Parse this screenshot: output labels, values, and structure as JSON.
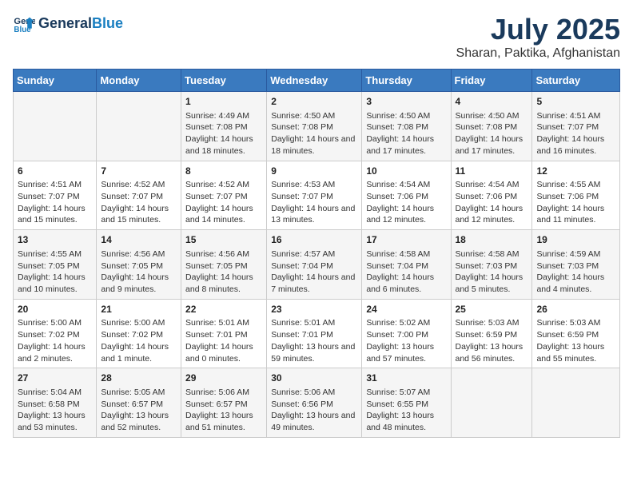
{
  "header": {
    "logo_line1": "General",
    "logo_line2": "Blue",
    "title": "July 2025",
    "subtitle": "Sharan, Paktika, Afghanistan"
  },
  "weekdays": [
    "Sunday",
    "Monday",
    "Tuesday",
    "Wednesday",
    "Thursday",
    "Friday",
    "Saturday"
  ],
  "weeks": [
    [
      {
        "day": "",
        "info": ""
      },
      {
        "day": "",
        "info": ""
      },
      {
        "day": "1",
        "info": "Sunrise: 4:49 AM\nSunset: 7:08 PM\nDaylight: 14 hours and 18 minutes."
      },
      {
        "day": "2",
        "info": "Sunrise: 4:50 AM\nSunset: 7:08 PM\nDaylight: 14 hours and 18 minutes."
      },
      {
        "day": "3",
        "info": "Sunrise: 4:50 AM\nSunset: 7:08 PM\nDaylight: 14 hours and 17 minutes."
      },
      {
        "day": "4",
        "info": "Sunrise: 4:50 AM\nSunset: 7:08 PM\nDaylight: 14 hours and 17 minutes."
      },
      {
        "day": "5",
        "info": "Sunrise: 4:51 AM\nSunset: 7:07 PM\nDaylight: 14 hours and 16 minutes."
      }
    ],
    [
      {
        "day": "6",
        "info": "Sunrise: 4:51 AM\nSunset: 7:07 PM\nDaylight: 14 hours and 15 minutes."
      },
      {
        "day": "7",
        "info": "Sunrise: 4:52 AM\nSunset: 7:07 PM\nDaylight: 14 hours and 15 minutes."
      },
      {
        "day": "8",
        "info": "Sunrise: 4:52 AM\nSunset: 7:07 PM\nDaylight: 14 hours and 14 minutes."
      },
      {
        "day": "9",
        "info": "Sunrise: 4:53 AM\nSunset: 7:07 PM\nDaylight: 14 hours and 13 minutes."
      },
      {
        "day": "10",
        "info": "Sunrise: 4:54 AM\nSunset: 7:06 PM\nDaylight: 14 hours and 12 minutes."
      },
      {
        "day": "11",
        "info": "Sunrise: 4:54 AM\nSunset: 7:06 PM\nDaylight: 14 hours and 12 minutes."
      },
      {
        "day": "12",
        "info": "Sunrise: 4:55 AM\nSunset: 7:06 PM\nDaylight: 14 hours and 11 minutes."
      }
    ],
    [
      {
        "day": "13",
        "info": "Sunrise: 4:55 AM\nSunset: 7:05 PM\nDaylight: 14 hours and 10 minutes."
      },
      {
        "day": "14",
        "info": "Sunrise: 4:56 AM\nSunset: 7:05 PM\nDaylight: 14 hours and 9 minutes."
      },
      {
        "day": "15",
        "info": "Sunrise: 4:56 AM\nSunset: 7:05 PM\nDaylight: 14 hours and 8 minutes."
      },
      {
        "day": "16",
        "info": "Sunrise: 4:57 AM\nSunset: 7:04 PM\nDaylight: 14 hours and 7 minutes."
      },
      {
        "day": "17",
        "info": "Sunrise: 4:58 AM\nSunset: 7:04 PM\nDaylight: 14 hours and 6 minutes."
      },
      {
        "day": "18",
        "info": "Sunrise: 4:58 AM\nSunset: 7:03 PM\nDaylight: 14 hours and 5 minutes."
      },
      {
        "day": "19",
        "info": "Sunrise: 4:59 AM\nSunset: 7:03 PM\nDaylight: 14 hours and 4 minutes."
      }
    ],
    [
      {
        "day": "20",
        "info": "Sunrise: 5:00 AM\nSunset: 7:02 PM\nDaylight: 14 hours and 2 minutes."
      },
      {
        "day": "21",
        "info": "Sunrise: 5:00 AM\nSunset: 7:02 PM\nDaylight: 14 hours and 1 minute."
      },
      {
        "day": "22",
        "info": "Sunrise: 5:01 AM\nSunset: 7:01 PM\nDaylight: 14 hours and 0 minutes."
      },
      {
        "day": "23",
        "info": "Sunrise: 5:01 AM\nSunset: 7:01 PM\nDaylight: 13 hours and 59 minutes."
      },
      {
        "day": "24",
        "info": "Sunrise: 5:02 AM\nSunset: 7:00 PM\nDaylight: 13 hours and 57 minutes."
      },
      {
        "day": "25",
        "info": "Sunrise: 5:03 AM\nSunset: 6:59 PM\nDaylight: 13 hours and 56 minutes."
      },
      {
        "day": "26",
        "info": "Sunrise: 5:03 AM\nSunset: 6:59 PM\nDaylight: 13 hours and 55 minutes."
      }
    ],
    [
      {
        "day": "27",
        "info": "Sunrise: 5:04 AM\nSunset: 6:58 PM\nDaylight: 13 hours and 53 minutes."
      },
      {
        "day": "28",
        "info": "Sunrise: 5:05 AM\nSunset: 6:57 PM\nDaylight: 13 hours and 52 minutes."
      },
      {
        "day": "29",
        "info": "Sunrise: 5:06 AM\nSunset: 6:57 PM\nDaylight: 13 hours and 51 minutes."
      },
      {
        "day": "30",
        "info": "Sunrise: 5:06 AM\nSunset: 6:56 PM\nDaylight: 13 hours and 49 minutes."
      },
      {
        "day": "31",
        "info": "Sunrise: 5:07 AM\nSunset: 6:55 PM\nDaylight: 13 hours and 48 minutes."
      },
      {
        "day": "",
        "info": ""
      },
      {
        "day": "",
        "info": ""
      }
    ]
  ]
}
